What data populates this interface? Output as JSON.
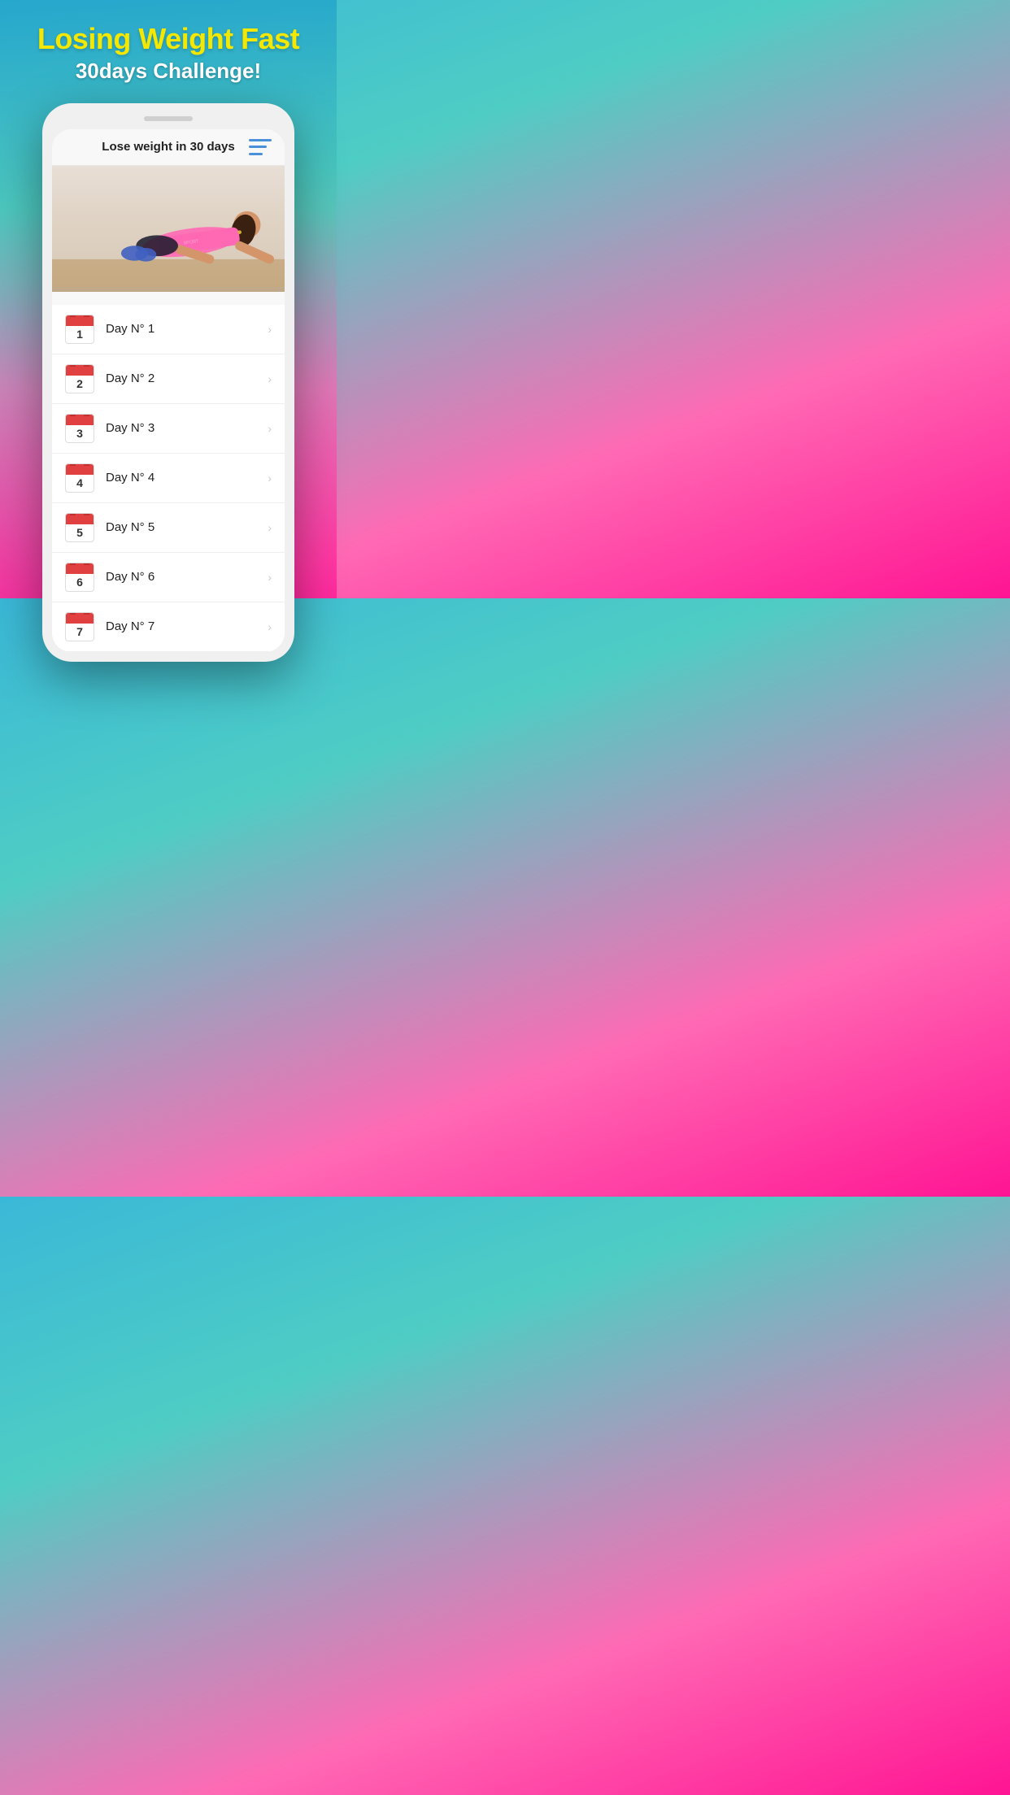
{
  "background": {
    "gradient_start": "#3ab8d8",
    "gradient_mid": "#4ecdc4",
    "gradient_end": "#ff1493"
  },
  "header": {
    "main_title": "Losing Weight Fast",
    "sub_title": "30days Challenge!"
  },
  "phone": {
    "speaker": true
  },
  "navbar": {
    "title": "Lose weight in 30 days",
    "menu_icon_color": "#4a90d9"
  },
  "workout_image": {
    "alt": "Woman doing push-up exercise"
  },
  "days": [
    {
      "number": "1",
      "label": "Day N° 1"
    },
    {
      "number": "2",
      "label": "Day N° 2"
    },
    {
      "number": "3",
      "label": "Day N° 3"
    },
    {
      "number": "4",
      "label": "Day N° 4"
    },
    {
      "number": "5",
      "label": "Day N° 5"
    },
    {
      "number": "6",
      "label": "Day N° 6"
    },
    {
      "number": "7",
      "label": "Day N° 7"
    }
  ]
}
